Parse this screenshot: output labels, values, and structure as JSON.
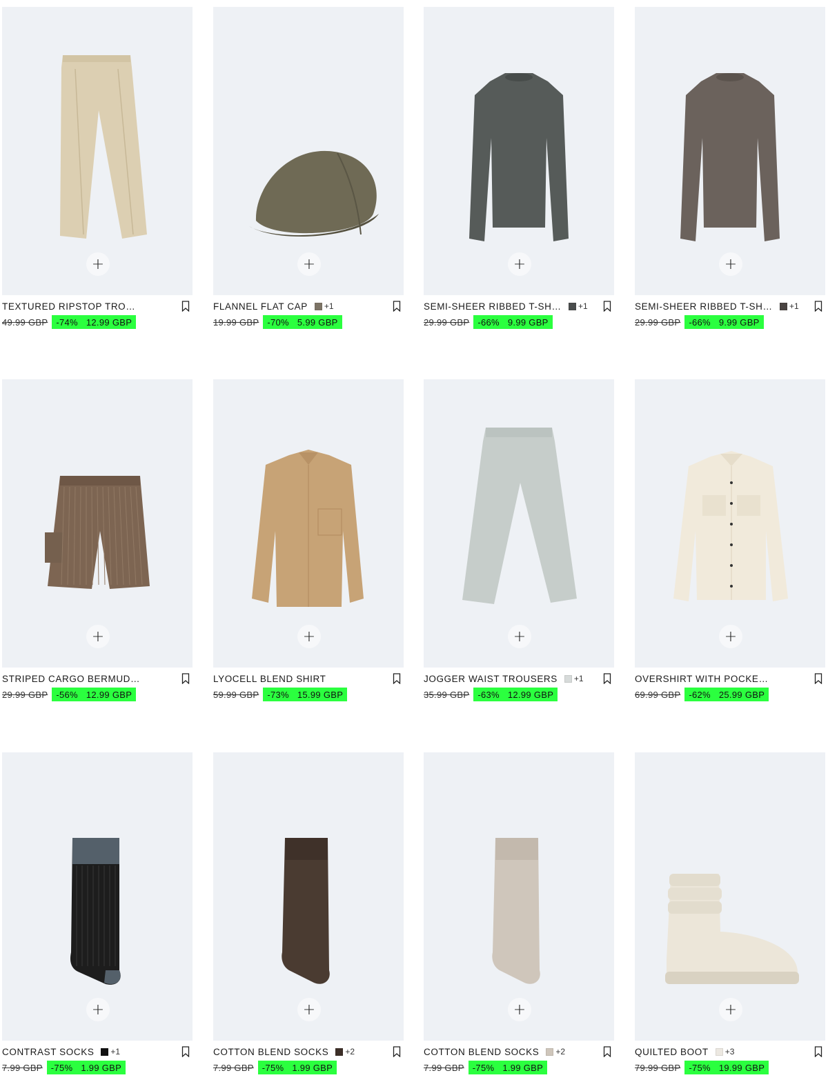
{
  "colors": {
    "sale_bg": "#2bff3f",
    "image_bg": "#eef1f5"
  },
  "add_label": "+",
  "products": [
    {
      "name": "TEXTURED RIPSTOP TROUSERS",
      "old": "49.99 GBP",
      "pct": "-74%",
      "price": "12.99 GBP",
      "swatch": "",
      "more": "",
      "icon": "trousers-image"
    },
    {
      "name": "FLANNEL FLAT CAP",
      "old": "19.99 GBP",
      "pct": "-70%",
      "price": "5.99 GBP",
      "swatch": "#7d7466",
      "more": "+1",
      "icon": "flat-cap-image"
    },
    {
      "name": "SEMI-SHEER RIBBED T-SHI...",
      "old": "29.99 GBP",
      "pct": "-66%",
      "price": "9.99 GBP",
      "swatch": "#4a4d4d",
      "more": "+1",
      "icon": "longsleeve-tee-image"
    },
    {
      "name": "SEMI-SHEER RIBBED T-SHI...",
      "old": "29.99 GBP",
      "pct": "-66%",
      "price": "9.99 GBP",
      "swatch": "#4a4442",
      "more": "+1",
      "icon": "longsleeve-tee-image"
    },
    {
      "name": "STRIPED CARGO BERMUDA SHO...",
      "old": "29.99 GBP",
      "pct": "-56%",
      "price": "12.99 GBP",
      "swatch": "",
      "more": "",
      "icon": "bermuda-shorts-image"
    },
    {
      "name": "LYOCELL BLEND SHIRT",
      "old": "59.99 GBP",
      "pct": "-73%",
      "price": "15.99 GBP",
      "swatch": "",
      "more": "",
      "icon": "shirt-image"
    },
    {
      "name": "JOGGER WAIST TROUSERS",
      "old": "35.99 GBP",
      "pct": "-63%",
      "price": "12.99 GBP",
      "swatch": "#d7dbda",
      "more": "+1",
      "icon": "jogger-trousers-image"
    },
    {
      "name": "OVERSHIRT WITH POCKETS X C...",
      "old": "69.99 GBP",
      "pct": "-62%",
      "price": "25.99 GBP",
      "swatch": "",
      "more": "",
      "icon": "overshirt-image"
    },
    {
      "name": "CONTRAST SOCKS",
      "old": "7.99 GBP",
      "pct": "-75%",
      "price": "1.99 GBP",
      "swatch": "#111111",
      "more": "+1",
      "icon": "socks-image"
    },
    {
      "name": "COTTON BLEND SOCKS",
      "old": "7.99 GBP",
      "pct": "-75%",
      "price": "1.99 GBP",
      "swatch": "#3d2f28",
      "more": "+2",
      "icon": "socks-image"
    },
    {
      "name": "COTTON BLEND SOCKS",
      "old": "7.99 GBP",
      "pct": "-75%",
      "price": "1.99 GBP",
      "swatch": "#cfc6bb",
      "more": "+2",
      "icon": "socks-image"
    },
    {
      "name": "QUILTED BOOT",
      "old": "79.99 GBP",
      "pct": "-75%",
      "price": "19.99 GBP",
      "swatch": "#ece8e1",
      "more": "+3",
      "icon": "boot-image"
    }
  ]
}
